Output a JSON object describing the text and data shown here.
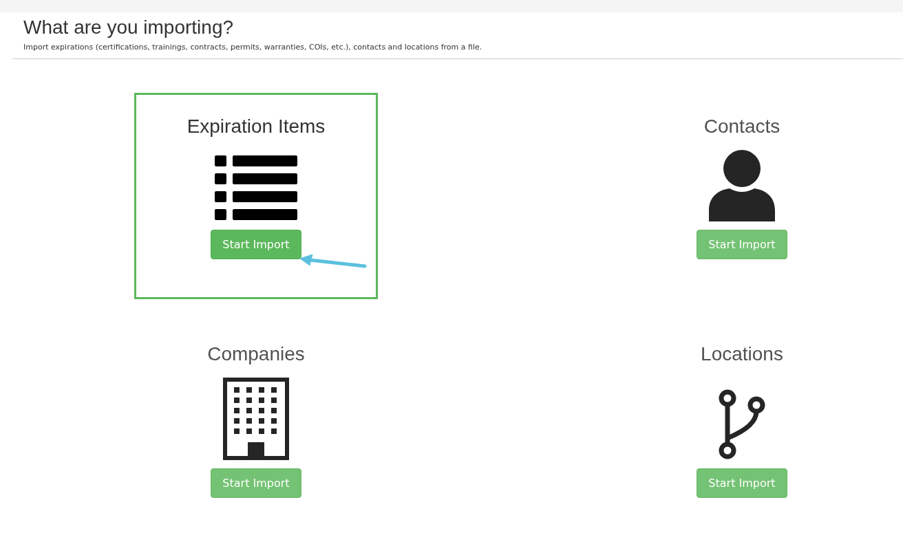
{
  "header": {
    "title": "What are you importing?",
    "subtitle": "Import expirations (certifications, trainings, contracts, permits, warranties, COIs, etc.), contacts and locations from a file."
  },
  "import_types": [
    {
      "kind": "list",
      "title": "Expiration Items",
      "button": "Start Import",
      "highlighted": true
    },
    {
      "kind": "person",
      "title": "Contacts",
      "button": "Start Import",
      "highlighted": false
    },
    {
      "kind": "building",
      "title": "Companies",
      "button": "Start Import",
      "highlighted": false
    },
    {
      "kind": "branch",
      "title": "Locations",
      "button": "Start Import",
      "highlighted": false
    }
  ]
}
